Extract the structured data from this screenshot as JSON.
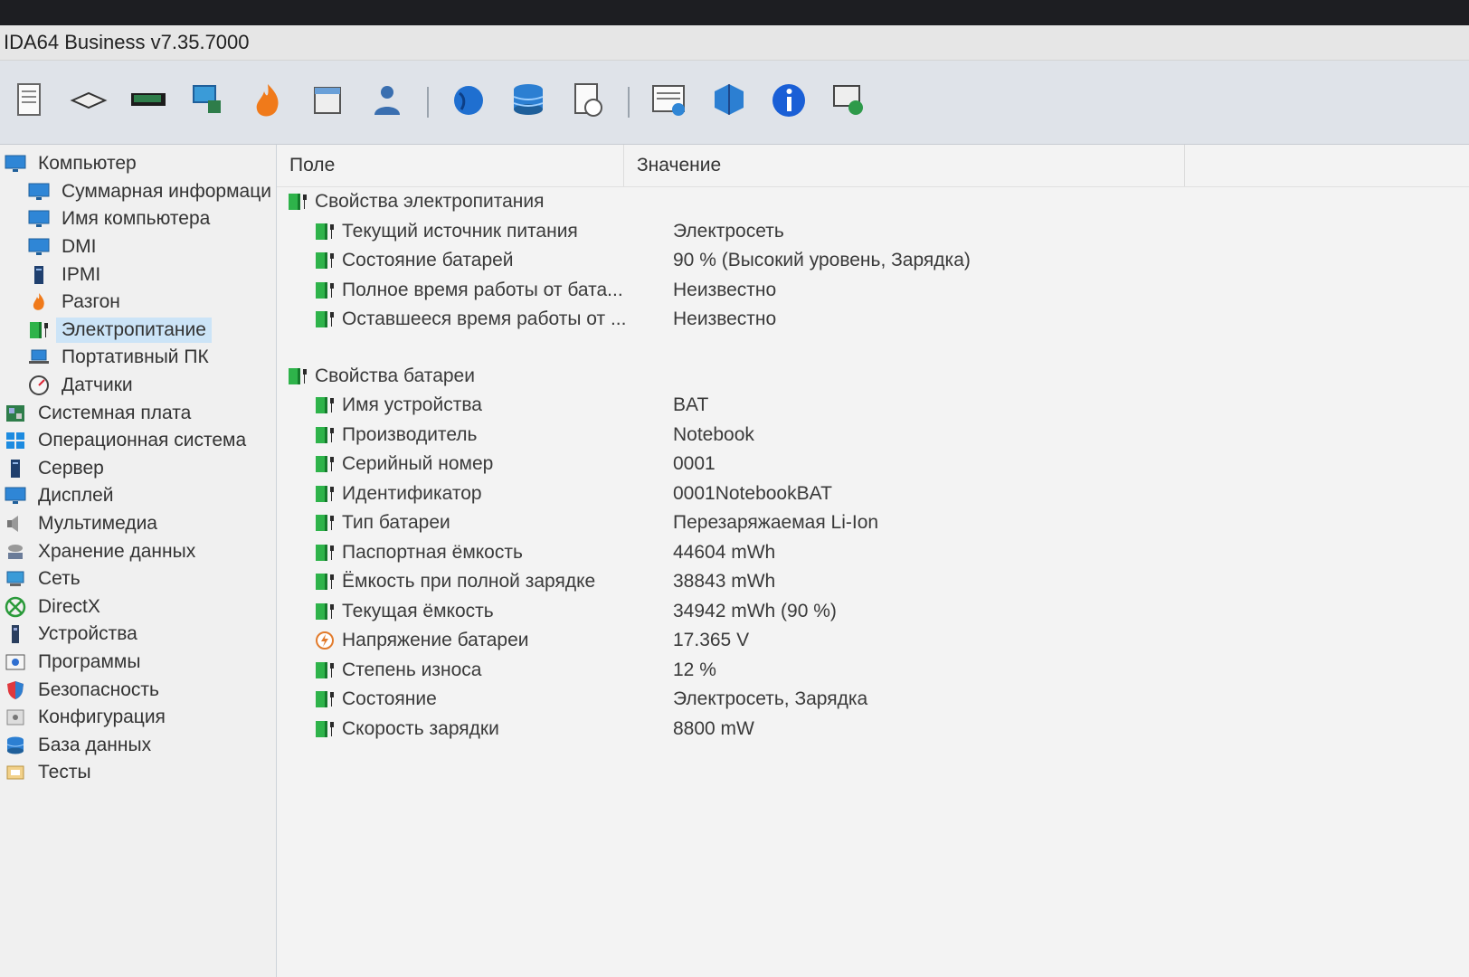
{
  "window": {
    "title": "IDA64 Business v7.35.7000"
  },
  "toolbar": {
    "buttons": [
      {
        "name": "report-icon"
      },
      {
        "name": "motherboard-icon"
      },
      {
        "name": "memory-icon"
      },
      {
        "name": "network-icon"
      },
      {
        "name": "overclock-icon"
      },
      {
        "name": "schedule-icon"
      },
      {
        "name": "user-icon"
      },
      {
        "name": "separator"
      },
      {
        "name": "globe-icon"
      },
      {
        "name": "database-icon"
      },
      {
        "name": "benchmark-icon"
      },
      {
        "name": "separator"
      },
      {
        "name": "display-report-icon"
      },
      {
        "name": "cube-icon"
      },
      {
        "name": "info-icon"
      },
      {
        "name": "monitor-tool-icon"
      }
    ]
  },
  "sidebar": {
    "items": [
      {
        "label": "Компьютер",
        "level": 0,
        "icon": "monitor-icon"
      },
      {
        "label": "Суммарная информаци",
        "level": 1,
        "icon": "monitor-icon"
      },
      {
        "label": "Имя компьютера",
        "level": 1,
        "icon": "monitor-icon"
      },
      {
        "label": "DMI",
        "level": 1,
        "icon": "monitor-icon"
      },
      {
        "label": "IPMI",
        "level": 1,
        "icon": "server-icon"
      },
      {
        "label": "Разгон",
        "level": 1,
        "icon": "flame-icon"
      },
      {
        "label": "Электропитание",
        "level": 1,
        "icon": "battery-icon",
        "selected": true
      },
      {
        "label": "Портативный ПК",
        "level": 1,
        "icon": "laptop-icon"
      },
      {
        "label": "Датчики",
        "level": 1,
        "icon": "gauge-icon"
      },
      {
        "label": "Системная плата",
        "level": 0,
        "icon": "motherboard-icon"
      },
      {
        "label": "Операционная система",
        "level": 0,
        "icon": "windows-icon"
      },
      {
        "label": "Сервер",
        "level": 0,
        "icon": "server-icon"
      },
      {
        "label": "Дисплей",
        "level": 0,
        "icon": "monitor-icon"
      },
      {
        "label": "Мультимедиа",
        "level": 0,
        "icon": "speaker-icon"
      },
      {
        "label": "Хранение данных",
        "level": 0,
        "icon": "storage-icon"
      },
      {
        "label": "Сеть",
        "level": 0,
        "icon": "network-icon"
      },
      {
        "label": "DirectX",
        "level": 0,
        "icon": "xbox-icon"
      },
      {
        "label": "Устройства",
        "level": 0,
        "icon": "device-icon"
      },
      {
        "label": "Программы",
        "level": 0,
        "icon": "programs-icon"
      },
      {
        "label": "Безопасность",
        "level": 0,
        "icon": "shield-icon"
      },
      {
        "label": "Конфигурация",
        "level": 0,
        "icon": "config-icon"
      },
      {
        "label": "База данных",
        "level": 0,
        "icon": "database-icon"
      },
      {
        "label": "Тесты",
        "level": 0,
        "icon": "tests-icon"
      }
    ]
  },
  "table": {
    "headers": {
      "field": "Поле",
      "value": "Значение"
    },
    "groups": [
      {
        "title": "Свойства электропитания",
        "rows": [
          {
            "field": "Текущий источник питания",
            "value": "Электросеть",
            "icon": "battery-icon"
          },
          {
            "field": "Состояние батарей",
            "value": "90 % (Высокий уровень, Зарядка)",
            "icon": "battery-icon"
          },
          {
            "field": "Полное время работы от бата...",
            "value": "Неизвестно",
            "icon": "battery-icon"
          },
          {
            "field": "Оставшееся время работы от ...",
            "value": "Неизвестно",
            "icon": "battery-icon"
          }
        ]
      },
      {
        "title": "Свойства батареи",
        "rows": [
          {
            "field": "Имя устройства",
            "value": "BAT",
            "icon": "battery-icon"
          },
          {
            "field": "Производитель",
            "value": "Notebook",
            "icon": "battery-icon"
          },
          {
            "field": "Серийный номер",
            "value": "0001",
            "icon": "battery-icon"
          },
          {
            "field": "Идентификатор",
            "value": "0001NotebookBAT",
            "icon": "battery-icon"
          },
          {
            "field": "Тип батареи",
            "value": "Перезаряжаемая Li-Ion",
            "icon": "battery-icon"
          },
          {
            "field": "Паспортная ёмкость",
            "value": "44604 mWh",
            "icon": "battery-icon"
          },
          {
            "field": "Ёмкость при полной зарядке",
            "value": "38843 mWh",
            "icon": "battery-icon"
          },
          {
            "field": "Текущая ёмкость",
            "value": "34942 mWh  (90 %)",
            "icon": "battery-icon"
          },
          {
            "field": "Напряжение батареи",
            "value": "17.365 V",
            "icon": "voltage-icon"
          },
          {
            "field": "Степень износа",
            "value": "12 %",
            "icon": "battery-icon"
          },
          {
            "field": "Состояние",
            "value": "Электросеть, Зарядка",
            "icon": "battery-icon"
          },
          {
            "field": "Скорость зарядки",
            "value": "8800 mW",
            "icon": "battery-icon"
          }
        ]
      }
    ]
  }
}
